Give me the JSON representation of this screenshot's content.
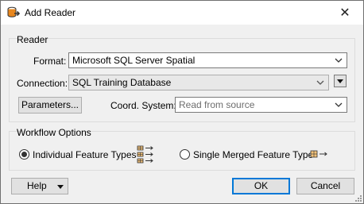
{
  "window": {
    "title": "Add Reader",
    "close_glyph": "✕"
  },
  "reader_group": {
    "label": "Reader",
    "format": {
      "label": "Format:",
      "value": "Microsoft SQL Server Spatial"
    },
    "connection": {
      "label": "Connection:",
      "value": "SQL Training Database"
    },
    "parameters_button": "Parameters...",
    "coord_system": {
      "label": "Coord. System:",
      "value": "Read from source"
    }
  },
  "workflow_group": {
    "label": "Workflow Options",
    "options": [
      {
        "label": "Individual Feature Types",
        "selected": true
      },
      {
        "label": "Single Merged Feature Type",
        "selected": false
      }
    ]
  },
  "footer": {
    "help_label": "Help",
    "ok_label": "OK",
    "cancel_label": "Cancel"
  },
  "icons": {
    "app": "reader-add-icon",
    "individual": "multiple-feature-types-icon",
    "merged": "single-feature-type-icon"
  },
  "colors": {
    "accent": "#0078d7",
    "icon_orange": "#e8871e"
  }
}
